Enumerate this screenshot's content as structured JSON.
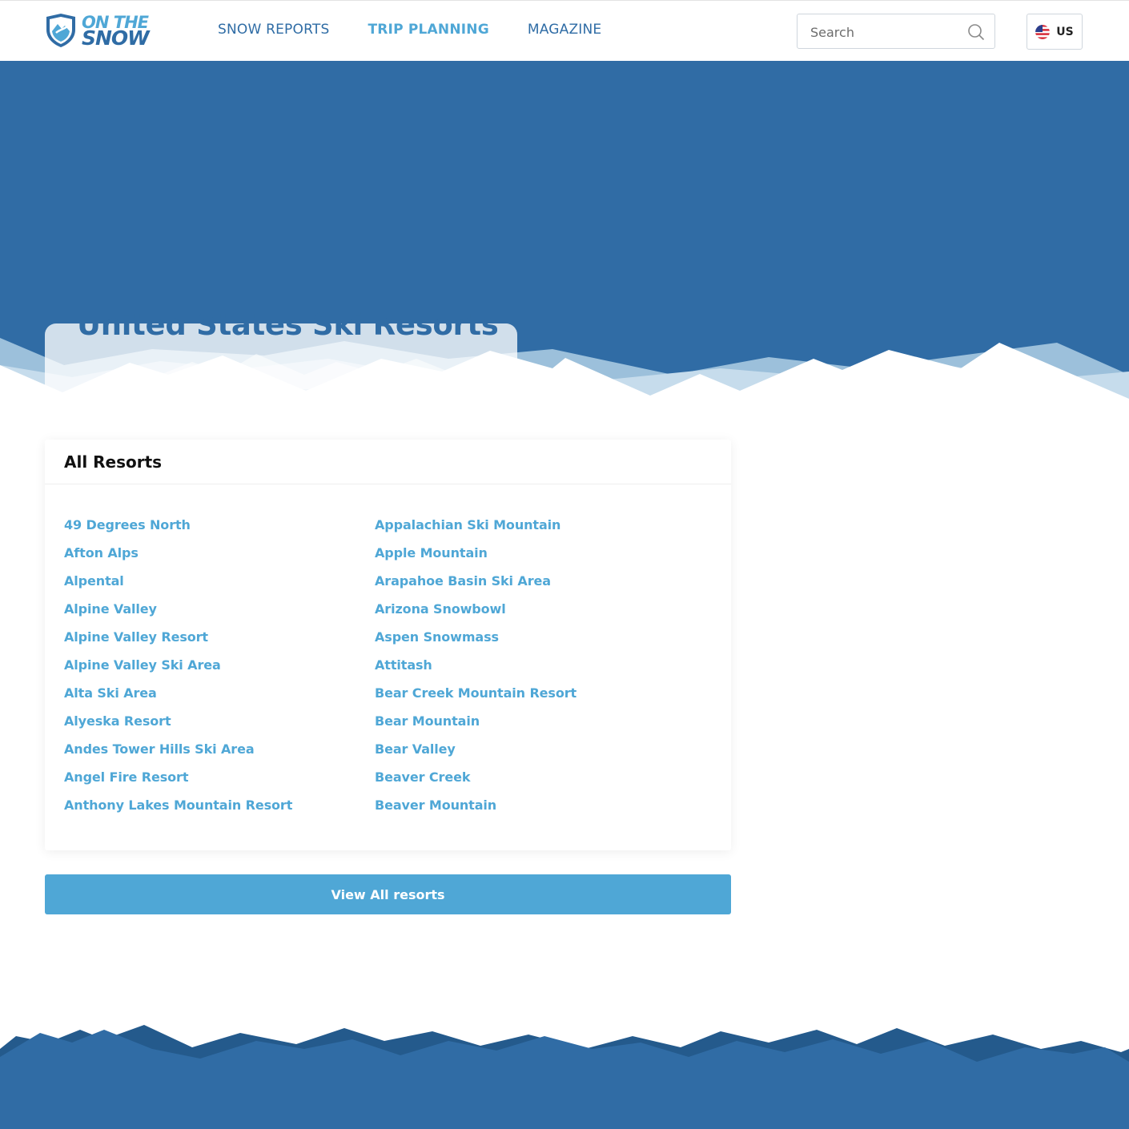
{
  "header": {
    "logo": {
      "line1": "ON THE",
      "line2": "SNOW"
    },
    "nav": [
      {
        "label": "SNOW REPORTS",
        "active": false
      },
      {
        "label": "TRIP PLANNING",
        "active": true
      },
      {
        "label": "MAGAZINE",
        "active": false
      }
    ],
    "search": {
      "placeholder": "Search",
      "value": ""
    },
    "locale": {
      "label": "US",
      "flag": "us-flag-icon"
    }
  },
  "hero": {
    "title": "United States Ski Resorts"
  },
  "resorts": {
    "title": "All Resorts",
    "left_column": [
      "49 Degrees North",
      "Afton Alps",
      "Alpental",
      "Alpine Valley",
      "Alpine Valley Resort",
      "Alpine Valley Ski Area",
      "Alta Ski Area",
      "Alyeska Resort",
      "Andes Tower Hills Ski Area",
      "Angel Fire Resort",
      "Anthony Lakes Mountain Resort"
    ],
    "right_column": [
      "Appalachian Ski Mountain",
      "Apple Mountain",
      "Arapahoe Basin Ski Area",
      "Arizona Snowbowl",
      "Aspen Snowmass",
      "Attitash",
      "Bear Creek Mountain Resort",
      "Bear Mountain",
      "Bear Valley",
      "Beaver Creek",
      "Beaver Mountain"
    ],
    "view_all_label": "View All resorts"
  },
  "colors": {
    "brand_dark": "#306ca5",
    "brand_light": "#4fa7d6",
    "hero_bg": "#306ca5"
  }
}
